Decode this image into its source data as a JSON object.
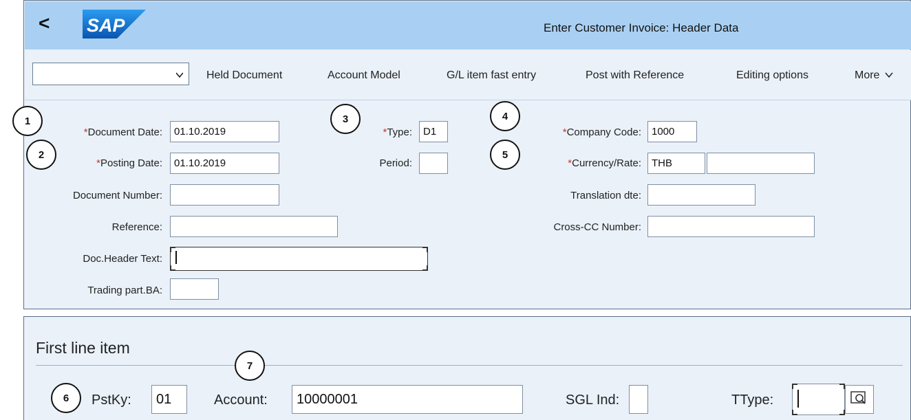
{
  "header": {
    "back_label": "<",
    "logo_text": "SAP",
    "title": "Enter Customer Invoice: Header Data"
  },
  "toolbar": {
    "variant_value": "",
    "items": [
      "Held Document",
      "Account Model",
      "G/L item fast entry",
      "Post with Reference",
      "Editing options",
      "More"
    ]
  },
  "form": {
    "document_date": {
      "label": "Document Date:",
      "value": "01.10.2019",
      "required": true
    },
    "posting_date": {
      "label": "Posting Date:",
      "value": "01.10.2019",
      "required": true
    },
    "document_number": {
      "label": "Document Number:",
      "value": ""
    },
    "reference": {
      "label": "Reference:",
      "value": ""
    },
    "doc_header_text": {
      "label": "Doc.Header Text:",
      "value": ""
    },
    "trading_part_ba": {
      "label": "Trading part.BA:",
      "value": ""
    },
    "type": {
      "label": "Type:",
      "value": "D1",
      "required": true
    },
    "period": {
      "label": "Period:",
      "value": ""
    },
    "company_code": {
      "label": "Company Code:",
      "value": "1000",
      "required": true
    },
    "currency_rate": {
      "label": "Currency/Rate:",
      "value": "THB",
      "rate_value": "",
      "required": true
    },
    "translation_dte": {
      "label": "Translation dte:",
      "value": ""
    },
    "cross_cc_number": {
      "label": "Cross-CC Number:",
      "value": ""
    }
  },
  "line_item": {
    "title": "First line item",
    "pstky": {
      "label": "PstKy:",
      "value": "01"
    },
    "account": {
      "label": "Account:",
      "value": "10000001"
    },
    "sgl_ind": {
      "label": "SGL Ind:",
      "value": ""
    },
    "ttype": {
      "label": "TType:",
      "value": ""
    }
  },
  "badges": [
    "1",
    "2",
    "3",
    "4",
    "5",
    "6",
    "7"
  ],
  "required_marker": "*",
  "colors": {
    "titlebar": "#a9d0f2",
    "panel": "#eaf1f9",
    "required": "#c0392b",
    "sap_blue": "#0a6ed1"
  }
}
